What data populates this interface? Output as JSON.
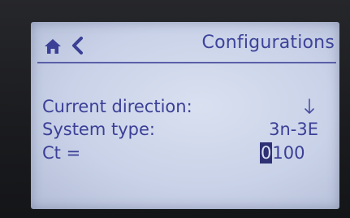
{
  "header": {
    "title": "Configurations",
    "home_icon": "home-icon",
    "back_icon": "chevron-left-icon"
  },
  "fields": [
    {
      "label": "Current direction:",
      "value": "↓",
      "icon": "arrow-down-icon"
    },
    {
      "label": "System type:",
      "value": "3n-3E"
    },
    {
      "label": "Ct =",
      "cursor_digit": "0",
      "rest_digits": "100"
    }
  ],
  "colors": {
    "screen_background": "#c9d2e8",
    "text": "#3b3f96",
    "cursor_highlight": "#2f3175"
  }
}
